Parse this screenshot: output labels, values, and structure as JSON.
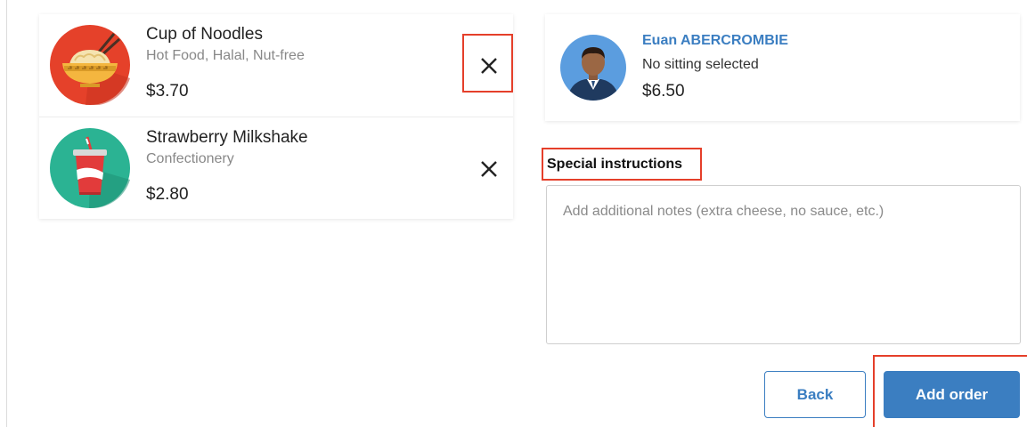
{
  "cart": {
    "items": [
      {
        "name": "Cup of Noodles",
        "tags": "Hot Food, Halal, Nut-free",
        "price": "$3.70",
        "icon": "noodles-bowl-icon"
      },
      {
        "name": "Strawberry Milkshake",
        "tags": "Confectionery",
        "price": "$2.80",
        "icon": "milkshake-cup-icon"
      }
    ],
    "remove_icon": "close-icon"
  },
  "person": {
    "name": "Euan ABERCROMBIE",
    "sitting": "No sitting selected",
    "total": "$6.50",
    "avatar_icon": "avatar-icon"
  },
  "instructions": {
    "label": "Special instructions",
    "placeholder": "Add additional notes (extra cheese, no sauce, etc.)",
    "value": ""
  },
  "actions": {
    "back_label": "Back",
    "add_label": "Add order"
  },
  "colors": {
    "accent": "#3b7ec1",
    "highlight": "#e53f2a",
    "noodle_bg": "#e5412a",
    "milkshake_bg": "#2bb393"
  }
}
